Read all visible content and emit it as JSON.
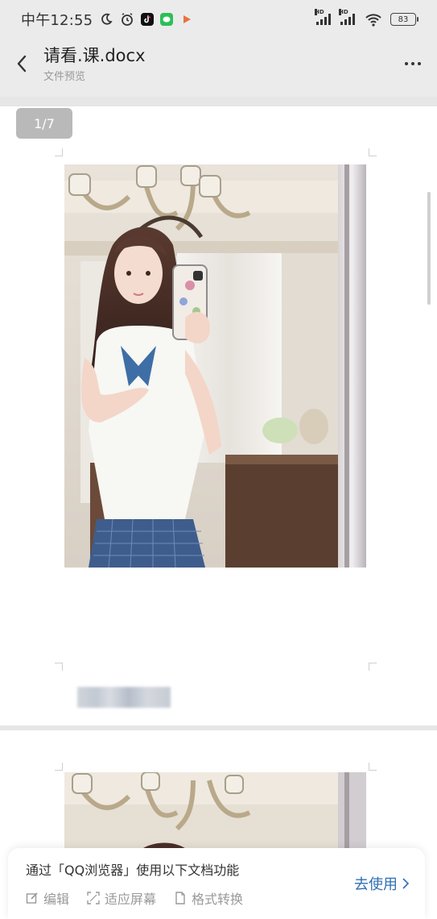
{
  "status_bar": {
    "time": "中午12:55",
    "battery": "83",
    "icons": [
      "moon-icon",
      "alarm-icon",
      "tiktok-icon",
      "wechat-icon",
      "play-icon",
      "signal-hd-1-icon",
      "signal-hd-2-icon",
      "wifi-icon",
      "battery-icon"
    ],
    "colors": {
      "tiktok": "#111111",
      "wechat": "#2dbf59",
      "play": "#e8733f"
    }
  },
  "header": {
    "title": "请看.课.docx",
    "subtitle": "文件预览",
    "back_icon": "chevron-left-icon",
    "more_icon": "more-horizontal-icon"
  },
  "viewer": {
    "page_indicator": "1/7",
    "background": "#e6e6e6",
    "pages": [
      {
        "image": "photo-girl-mirror-selfie",
        "caption": "blurred-text"
      },
      {
        "image": "photo-chandelier-partial"
      }
    ]
  },
  "promo": {
    "text": "通过「QQ浏览器」使用以下文档功能",
    "features": [
      {
        "icon": "edit-icon",
        "label": "编辑"
      },
      {
        "icon": "fit-screen-icon",
        "label": "适应屏幕"
      },
      {
        "icon": "file-convert-icon",
        "label": "格式转换"
      }
    ],
    "cta": "去使用",
    "cta_icon": "chevron-right-icon",
    "accent_color": "#2f6fb5"
  }
}
